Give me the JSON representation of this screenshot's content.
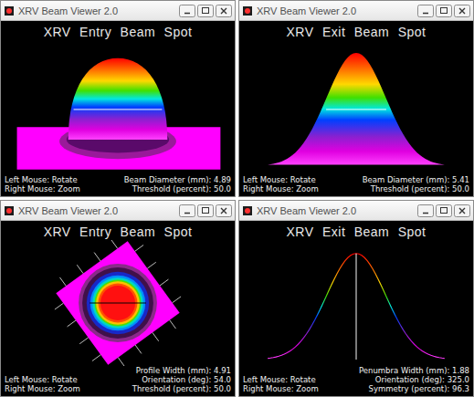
{
  "window": {
    "title": "XRV Beam Viewer 2.0"
  },
  "panels": [
    {
      "kind": "dome",
      "title": "XRV Entry Beam Spot",
      "hints": [
        "Left Mouse: Rotate",
        "Right Mouse: Zoom"
      ],
      "readings": [
        {
          "label": "Beam Diameter (mm):",
          "value": "4.89"
        },
        {
          "label": "Threshold (percent):",
          "value": "50.0"
        }
      ]
    },
    {
      "kind": "bell",
      "title": "XRV Exit Beam Spot",
      "hints": [
        "Left Mouse: Rotate",
        "Right Mouse: Zoom"
      ],
      "readings": [
        {
          "label": "Beam Diameter (mm):",
          "value": "5.41"
        },
        {
          "label": "Threshold (percent):",
          "value": "50.0"
        }
      ]
    },
    {
      "kind": "spot",
      "title": "XRV Entry Beam Spot",
      "hints": [
        "Left Mouse: Rotate",
        "Right Mouse: Zoom"
      ],
      "readings": [
        {
          "label": "Profile Width (mm):",
          "value": "4.91"
        },
        {
          "label": "Orientation (deg):",
          "value": "54.0"
        },
        {
          "label": "Threshold (percent):",
          "value": "50.0"
        }
      ]
    },
    {
      "kind": "curve",
      "title": "XRV Exit Beam Spot",
      "hints": [
        "Left Mouse: Rotate",
        "Right Mouse: Zoom"
      ],
      "readings": [
        {
          "label": "Penumbra Width (mm):",
          "value": "1.88"
        },
        {
          "label": "Orientation (deg):",
          "value": "325.0"
        },
        {
          "label": "Symmetry (percent):",
          "value": "96.3"
        }
      ]
    }
  ]
}
